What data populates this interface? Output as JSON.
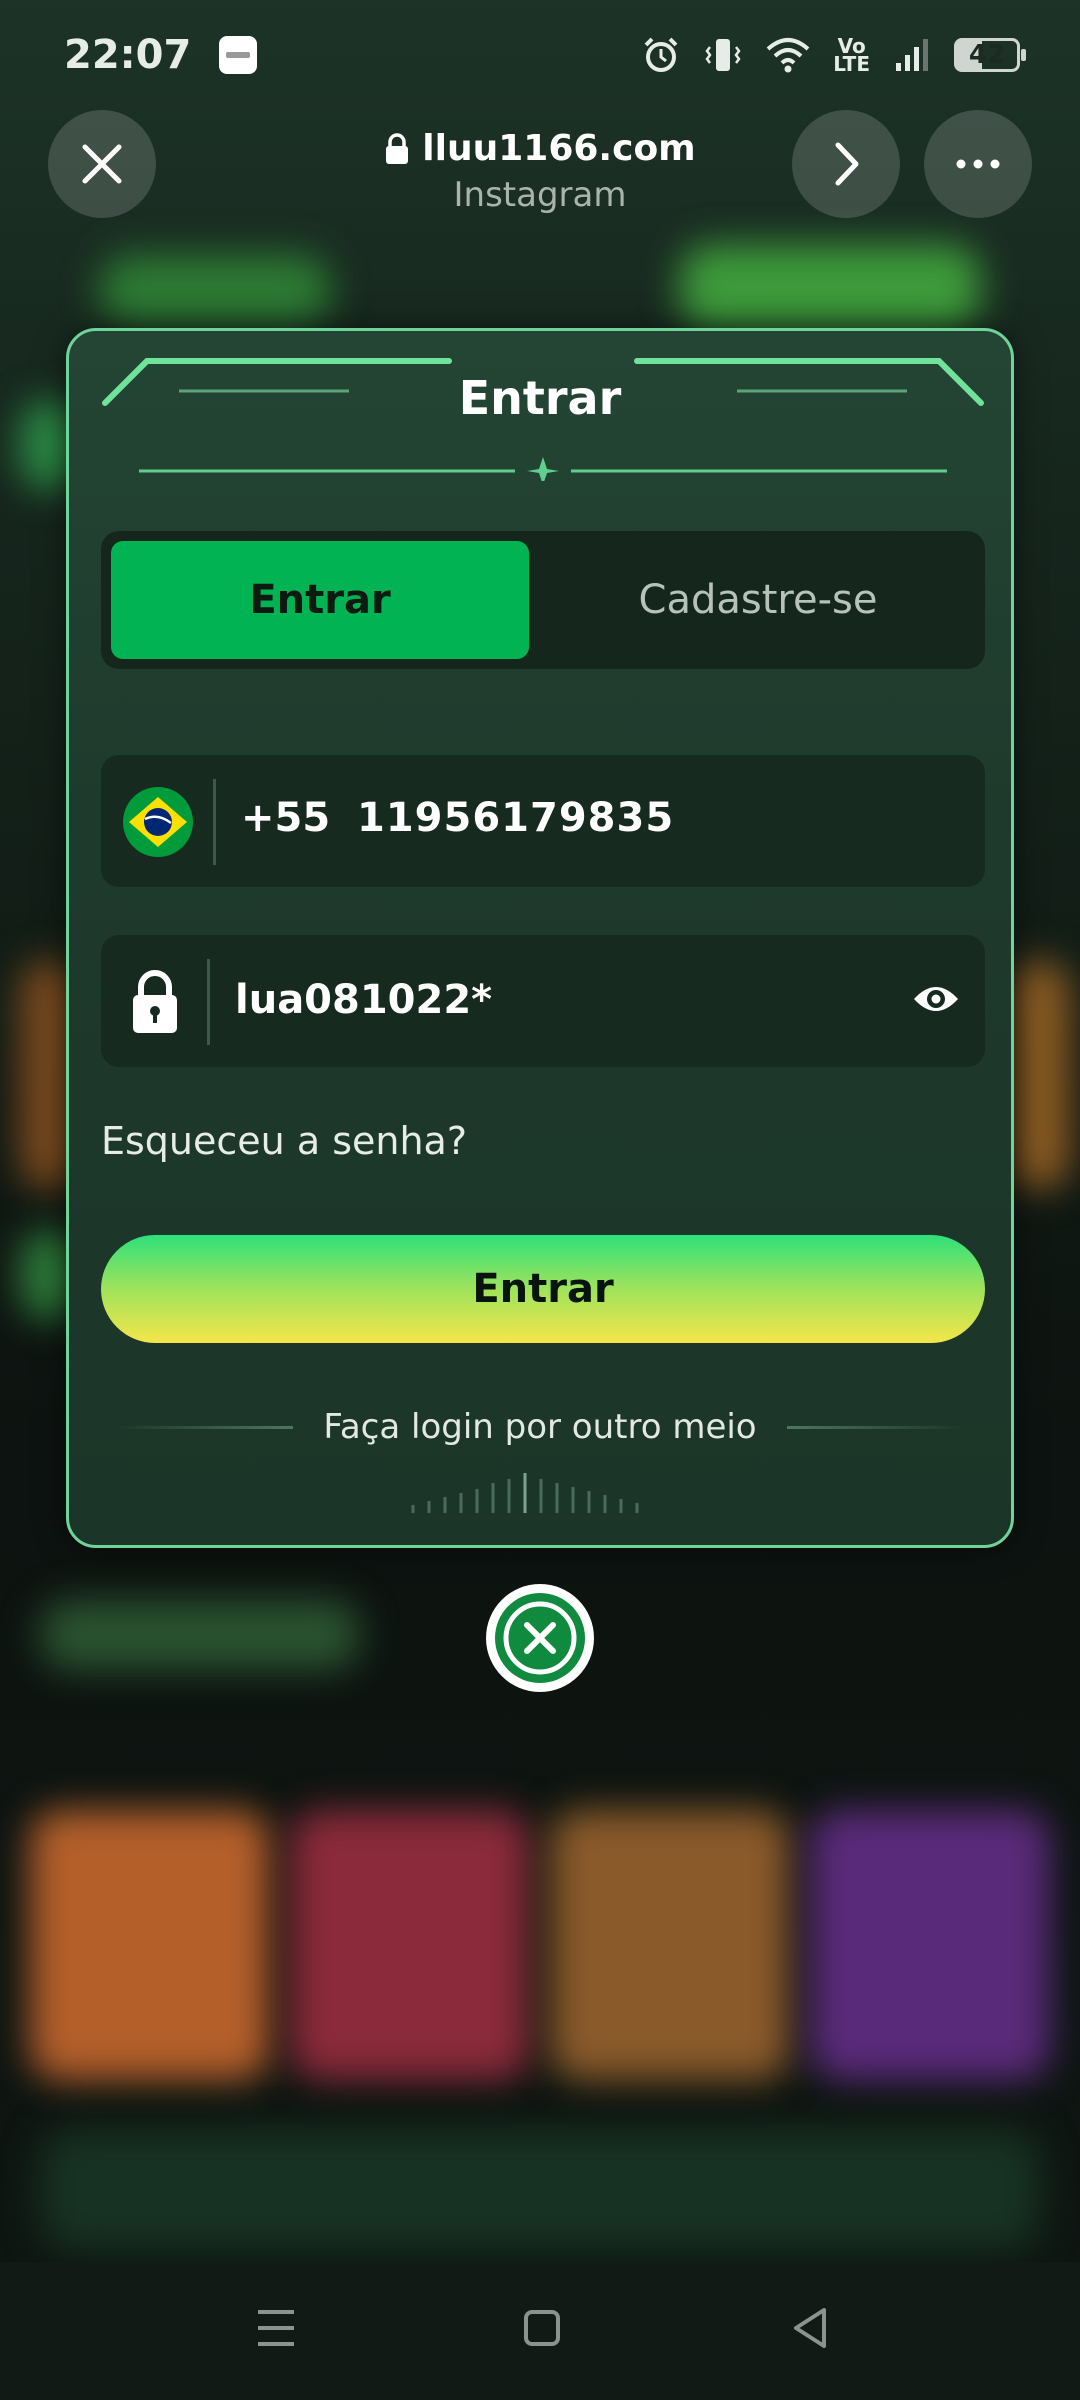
{
  "status_bar": {
    "time": "22:07",
    "network": "Vo\nLTE",
    "battery": "42"
  },
  "browser": {
    "url": "lluu1166.com",
    "source": "Instagram",
    "close_icon": "close-icon",
    "forward_icon": "chevron-right-icon",
    "more_icon": "more-icon"
  },
  "dialog": {
    "title": "Entrar",
    "tabs": [
      {
        "label": "Entrar",
        "active": true
      },
      {
        "label": "Cadastre-se",
        "active": false
      }
    ],
    "phone": {
      "country_code": "+55",
      "number": "11956179835",
      "flag": "brazil-flag-icon"
    },
    "password": {
      "value": "lua081022*",
      "icon": "lock-icon",
      "toggle_icon": "eye-icon"
    },
    "forgot_label": "Esqueceu a senha?",
    "submit_label": "Entrar",
    "alt_login_label": "Faça login por outro meio"
  },
  "colors": {
    "accent": "#02b353",
    "border": "#6fd39a",
    "dialog_bg": "#1e3a2c",
    "button_top": "#2fe07b",
    "button_bottom": "#f4e64a"
  }
}
